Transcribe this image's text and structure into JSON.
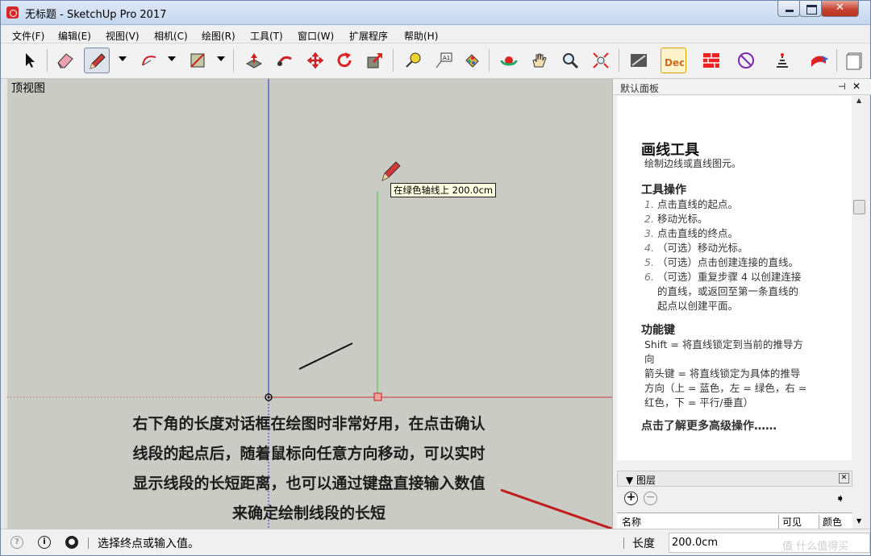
{
  "window": {
    "title": "无标题 - SketchUp Pro 2017",
    "close_label": "✕"
  },
  "menu": [
    "文件(F)",
    "编辑(E)",
    "视图(V)",
    "相机(C)",
    "绘图(R)",
    "工具(T)",
    "窗口(W)",
    "扩展程序",
    "帮助(H)"
  ],
  "toolbar": {
    "tools": [
      "select-icon",
      "eraser-icon",
      "pencil-icon",
      "arc-icon",
      "rectangle-icon",
      "push-pull-icon",
      "follow-me-icon",
      "move-icon",
      "rotate-icon",
      "scale-icon",
      "tape-measure-icon",
      "text-icon",
      "paint-bucket-icon",
      "orbit-icon",
      "pan-icon",
      "zoom-icon",
      "zoom-extents-icon",
      "3d-warehouse-icon",
      "dec-icon",
      "layout-icon",
      "sandbox-icon",
      "dynamic-components-icon",
      "export-icon",
      "style-icon"
    ],
    "dec_label": "Dec"
  },
  "viewport": {
    "view_name": "顶视图",
    "tooltip": "在绿色轴线上 200.0cm",
    "overlay_text": "右下角的长度对话框在绘图时非常好用，在点击确认线段的起点后，随着鼠标向任意方向移动，可以实时显示线段的长短距离，也可以通过键盘直接输入数值来确定绘制线段的长短",
    "axis_colors": {
      "blue": "#2a2ad6",
      "green": "#33cc33",
      "red": "#cc3333"
    }
  },
  "panel": {
    "title": "默认面板",
    "pin": "⊣",
    "close": "✕",
    "help": {
      "title": "画线工具",
      "subtitle": "绘制边线或直线图元。",
      "ops_title": "工具操作",
      "ops": [
        {
          "n": "1.",
          "t": "点击直线的起点。"
        },
        {
          "n": "2.",
          "t": "移动光标。"
        },
        {
          "n": "3.",
          "t": "点击直线的终点。"
        },
        {
          "n": "4.",
          "t": "（可选）移动光标。"
        },
        {
          "n": "5.",
          "t": "（可选）点击创建连接的直线。"
        },
        {
          "n": "6.",
          "t": "（可选）重复步骤 4 以创建连接"
        }
      ],
      "ops_cont": [
        "的直线，或返回至第一条直线的",
        "起点以创建平面。"
      ],
      "keys_title": "功能键",
      "keys": [
        "Shift = 将直线锁定到当前的推导方",
        "向",
        "箭头键 = 将直线锁定为具体的推导",
        "方向（上 = 蓝色，左 = 绿色，右 =",
        "红色，下 = 平行/垂直）"
      ],
      "more_link": "点击了解更多高级操作……"
    },
    "layers": {
      "title": "▼  图层",
      "add": "+",
      "remove": "−",
      "detail": "➧",
      "columns": [
        "名称",
        "可见",
        "颜色"
      ]
    }
  },
  "statusbar": {
    "message": "选择终点或输入值。",
    "measure_label": "长度",
    "measure_value": "200.0cm",
    "watermark": "值 什么值得买"
  }
}
